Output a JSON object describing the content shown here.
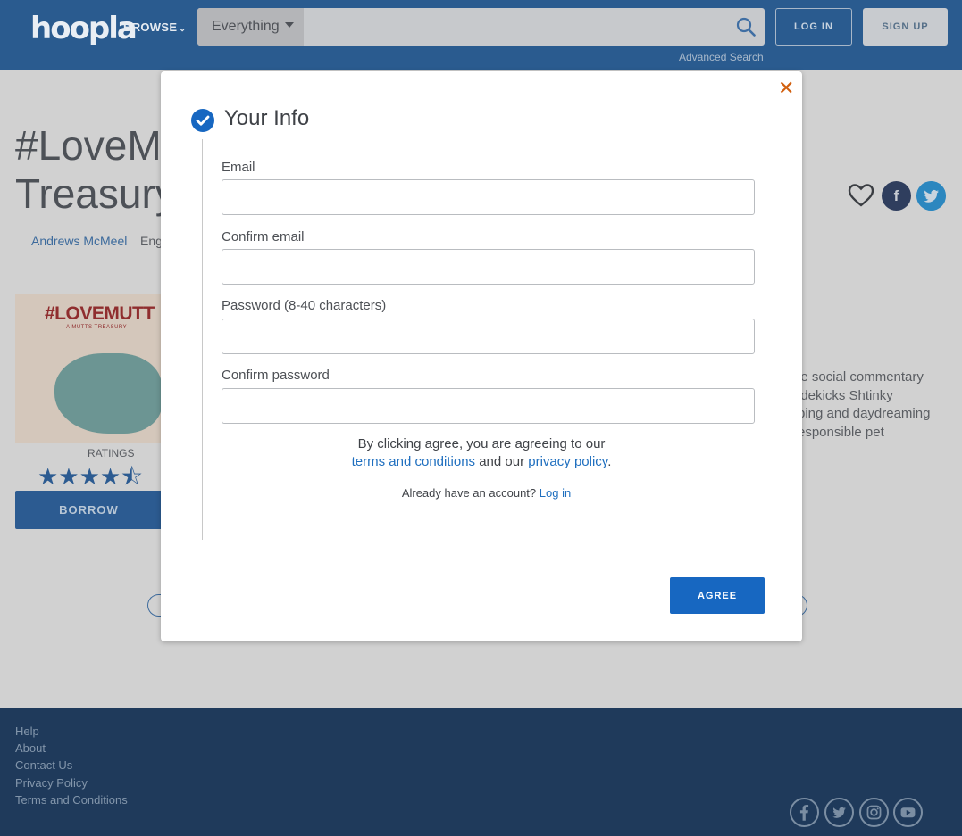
{
  "header": {
    "logo": "hoopla",
    "browse_label": "BROWSE",
    "search_type": "Everything",
    "search_placeholder": "",
    "advanced_search": "Advanced Search",
    "login_label": "LOG IN",
    "signup_label": "SIGN UP",
    "color": "#2a5b8f"
  },
  "title": {
    "line1": "#LoveM",
    "line2": "Treasury"
  },
  "meta": {
    "publisher": "Andrews McMeel",
    "language": "Eng"
  },
  "cover": {
    "title": "#LOVEMUTT",
    "subtitle": "A MUTTS TREASURY"
  },
  "ratings_label": "RATINGS",
  "stars": "★★★★⯪",
  "borrow_label": "BORROW",
  "description_lines": [
    "le social commentary",
    "idekicks Shtinky",
    "ping and daydreaming",
    "esponsible pet"
  ],
  "modal": {
    "close_glyph": "✕",
    "title": "Your Info",
    "fields": [
      {
        "label": "Email",
        "value": ""
      },
      {
        "label": "Confirm email",
        "value": ""
      },
      {
        "label": "Password (8-40 characters)",
        "value": ""
      },
      {
        "label": "Confirm password",
        "value": ""
      }
    ],
    "agree_prefix": "By clicking agree, you are agreeing to our",
    "terms_link": "terms and conditions",
    "and_our": "and our",
    "privacy_link": "privacy policy",
    "period": ".",
    "already_text": "Already have an account?",
    "login_link": "Log in",
    "agree_button": "AGREE",
    "accent": "#1767c1",
    "close_color": "#d2600f"
  },
  "footer": {
    "links": [
      "Help",
      "About",
      "Contact Us",
      "Privacy Policy",
      "Terms and Conditions"
    ],
    "social": [
      "facebook-icon",
      "twitter-icon",
      "instagram-icon",
      "youtube-icon"
    ]
  }
}
